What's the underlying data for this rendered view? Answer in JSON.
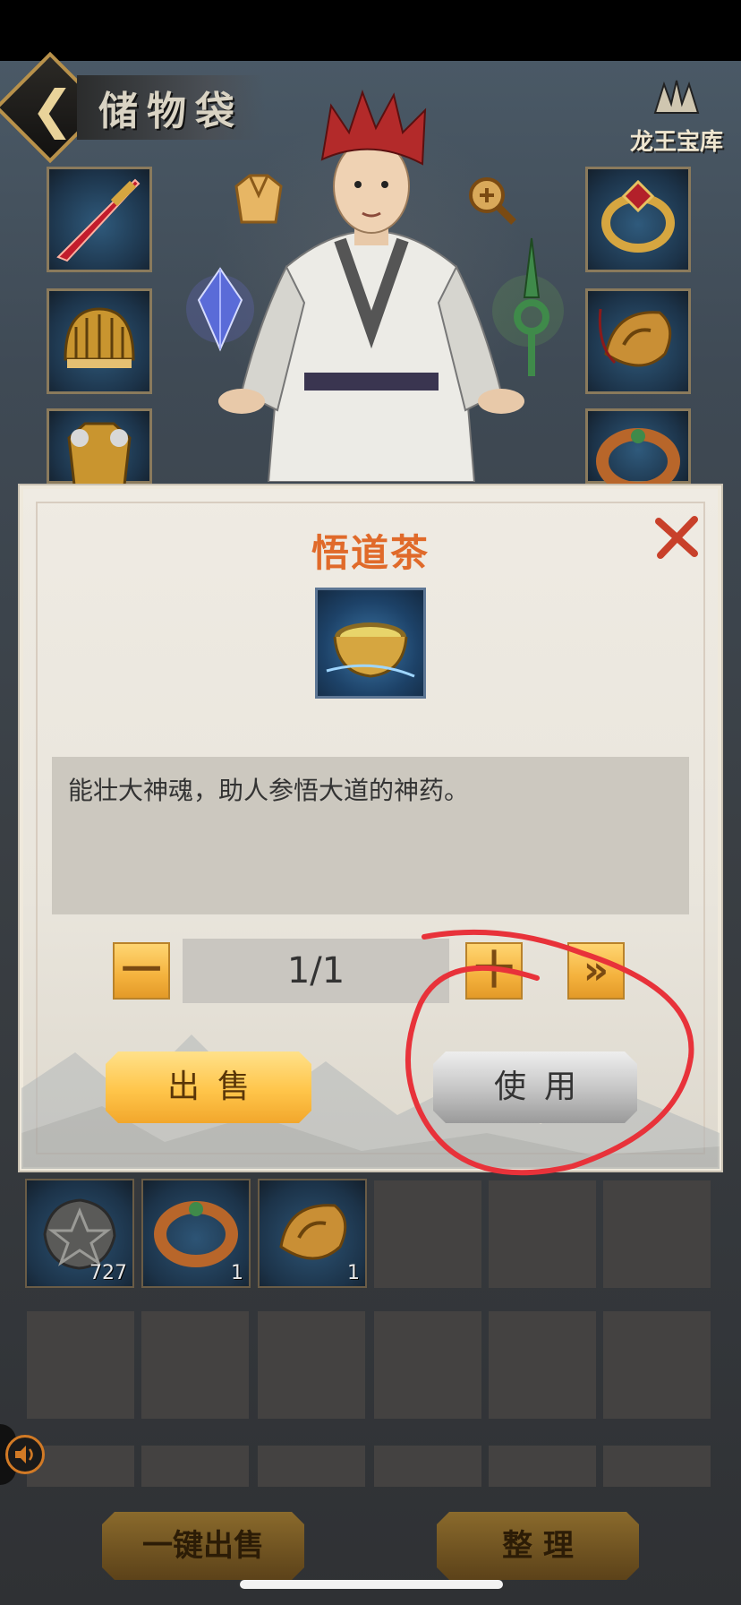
{
  "header": {
    "title": "储物袋",
    "back_icon": "back-arrow-icon",
    "treasury_label": "龙王宝库"
  },
  "equipment": {
    "left_slots": [
      "sword-icon",
      "helmet-icon",
      "armor-icon"
    ],
    "right_slots": [
      "ring-icon",
      "jade-pendant-icon",
      "bracelet-icon"
    ],
    "overlay_icons": [
      "robe-icon",
      "zoom-icon",
      "crystal-icon",
      "green-dagger-icon"
    ]
  },
  "item_dialog": {
    "title": "悟道茶",
    "icon": "tea-bowl-icon",
    "description": "能壮大神魂，助人参悟大道的神药。",
    "quantity": "1/1",
    "minus_label": "一",
    "plus_label": "十",
    "max_label": "»",
    "sell_label": "出售",
    "use_label": "使用",
    "close_icon": "close-icon"
  },
  "inventory": {
    "items": [
      {
        "icon": "dark-stone-icon",
        "count": "727"
      },
      {
        "icon": "bracelet-icon",
        "count": "1"
      },
      {
        "icon": "jade-pendant-icon",
        "count": "1"
      }
    ]
  },
  "bottom_bar": {
    "sell_all_label": "一键出售",
    "sort_label": "整 理"
  },
  "colors": {
    "title_orange": "#e06a2a",
    "gold_button": "#ffc54a",
    "annotation_red": "#e8323a"
  }
}
